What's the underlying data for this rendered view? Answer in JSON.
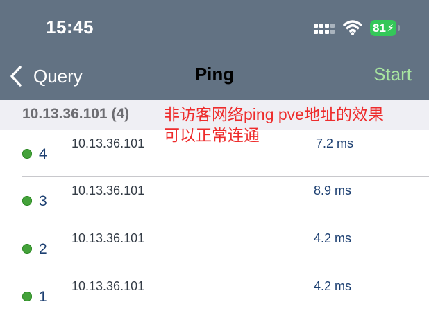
{
  "status_bar": {
    "time": "15:45",
    "battery": "81",
    "signal_icon": "cellular-signal-icon",
    "wifi_icon": "wifi-icon"
  },
  "nav": {
    "back_label": "Query",
    "title": "Ping",
    "action_label": "Start",
    "action_color": "#a8e6a0"
  },
  "section": {
    "title": "10.13.36.101 (4)"
  },
  "annotation": {
    "line1": "非访客网络ping pve地址的效果",
    "line2": "可以正常连通"
  },
  "rows": [
    {
      "seq": "4",
      "ip": "10.13.36.101",
      "time": "7.2 ms",
      "status": "success"
    },
    {
      "seq": "3",
      "ip": "10.13.36.101",
      "time": "8.9 ms",
      "status": "success"
    },
    {
      "seq": "2",
      "ip": "10.13.36.101",
      "time": "4.2 ms",
      "status": "success"
    },
    {
      "seq": "1",
      "ip": "10.13.36.101",
      "time": "4.2 ms",
      "status": "success"
    }
  ],
  "colors": {
    "nav_background": "#627283",
    "success_dot": "#44a23a",
    "annotation": "#ee2c2c"
  }
}
